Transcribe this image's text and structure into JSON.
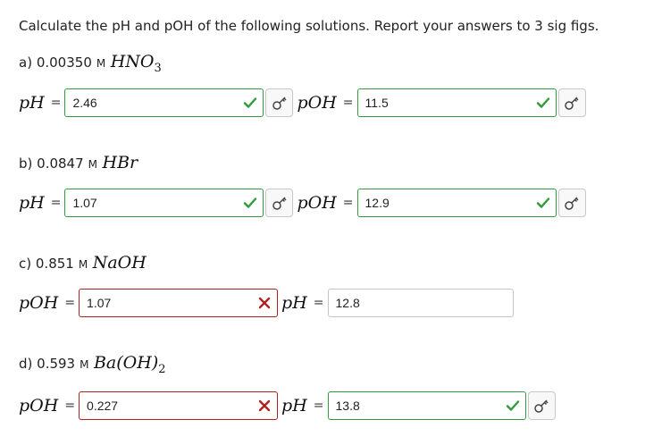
{
  "prompt": "Calculate the pH and pOH of the following solutions. Report your answers to 3 sig figs.",
  "parts": [
    {
      "letter": "a)",
      "conc": "0.00350",
      "unit": "M",
      "formula": "HNO",
      "subscript": "3",
      "formula_tail": "",
      "first_label": "pH",
      "first_value": "2.46",
      "first_status": "correct",
      "second_label": "pOH",
      "second_value": "11.5",
      "second_status": "correct"
    },
    {
      "letter": "b)",
      "conc": "0.0847",
      "unit": "M",
      "formula": "HBr",
      "subscript": "",
      "formula_tail": "",
      "first_label": "pH",
      "first_value": "1.07",
      "first_status": "correct",
      "second_label": "pOH",
      "second_value": "12.9",
      "second_status": "correct"
    },
    {
      "letter": "c)",
      "conc": "0.851",
      "unit": "M",
      "formula": "NaOH",
      "subscript": "",
      "formula_tail": "",
      "first_label": "pOH",
      "first_value": "1.07",
      "first_status": "wrong",
      "second_label": "pH",
      "second_value": "12.8",
      "second_status": "none"
    },
    {
      "letter": "d)",
      "conc": "0.593",
      "unit": "M",
      "formula": "Ba(OH)",
      "subscript": "2",
      "formula_tail": "",
      "first_label": "pOH",
      "first_value": "0.227",
      "first_status": "wrong",
      "second_label": "pH",
      "second_value": "13.8",
      "second_status": "correct"
    }
  ],
  "colors": {
    "correct": "#2e9e3c",
    "wrong": "#b02020",
    "neutral": "#c4c4c4"
  },
  "icons": {
    "correct": "check-icon",
    "wrong": "x-icon",
    "key": "key-icon"
  }
}
